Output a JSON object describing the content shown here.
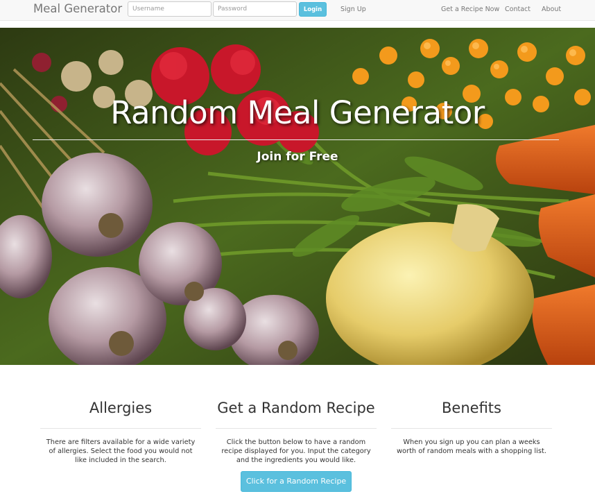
{
  "navbar": {
    "brand": "Meal Generator",
    "username_placeholder": "Username",
    "password_placeholder": "Password",
    "login_label": "Login",
    "signup_label": "Sign Up",
    "links": [
      "Get a Recipe Now",
      "Contact",
      "About"
    ]
  },
  "hero": {
    "title": "Random Meal Generator",
    "subtitle": "Join for Free"
  },
  "features": [
    {
      "heading": "Allergies",
      "text": "There are filters available for a wide variety of allergies. Select the food you would not like included in the search."
    },
    {
      "heading": "Get a Random Recipe",
      "text": "Click the button below to have a random recipe displayed for you. Input the category and the ingredients you would like.",
      "button_label": "Click for a Random Recipe"
    },
    {
      "heading": "Benefits",
      "text": "When you sign up you can plan a weeks worth of random meals with a shopping list."
    }
  ],
  "colors": {
    "accent": "#5bc0de",
    "navbar_bg": "#f8f8f8"
  }
}
